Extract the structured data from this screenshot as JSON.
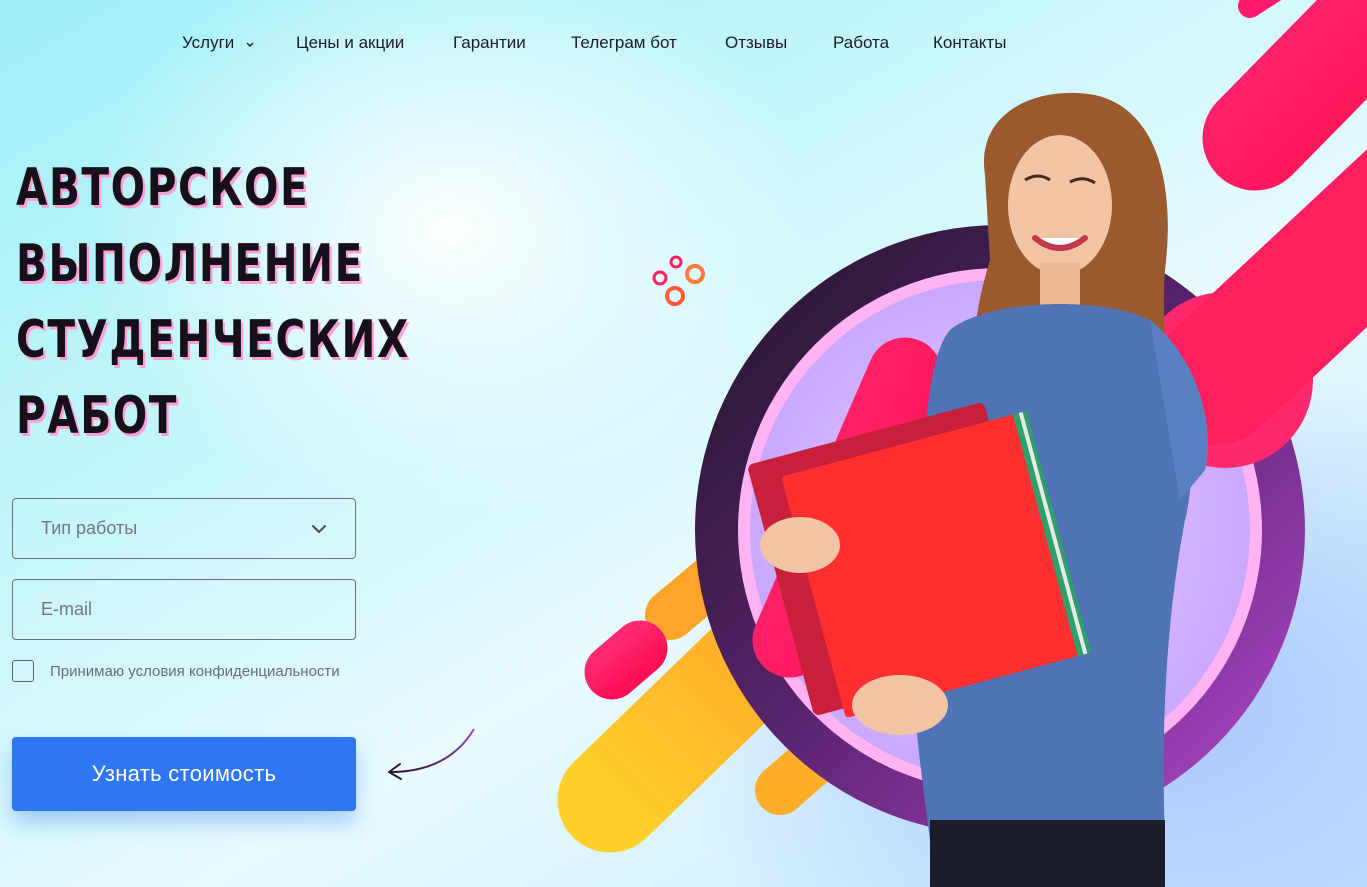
{
  "nav": {
    "items": [
      {
        "label": "Услуги",
        "has_dropdown": true
      },
      {
        "label": "Цены и акции"
      },
      {
        "label": "Гарантии"
      },
      {
        "label": "Телеграм бот"
      },
      {
        "label": "Отзывы"
      },
      {
        "label": "Работа"
      },
      {
        "label": "Контакты"
      }
    ]
  },
  "hero": {
    "title_lines": [
      "Авторское",
      "выполнение",
      "студенческих",
      "работ"
    ]
  },
  "form": {
    "work_type_placeholder": "Тип работы",
    "email_placeholder": "E-mail",
    "consent_label": "Принимаю условия конфиденциальности",
    "submit_label": "Узнать стоимость"
  },
  "colors": {
    "accent_blue": "#2f76f3",
    "pink": "#ff1a6b",
    "orange": "#ffb02a",
    "purple_ring": "#6a2a86"
  },
  "icons": {
    "dropdown": "chevron-down-icon",
    "arrow": "curved-arrow-icon"
  }
}
